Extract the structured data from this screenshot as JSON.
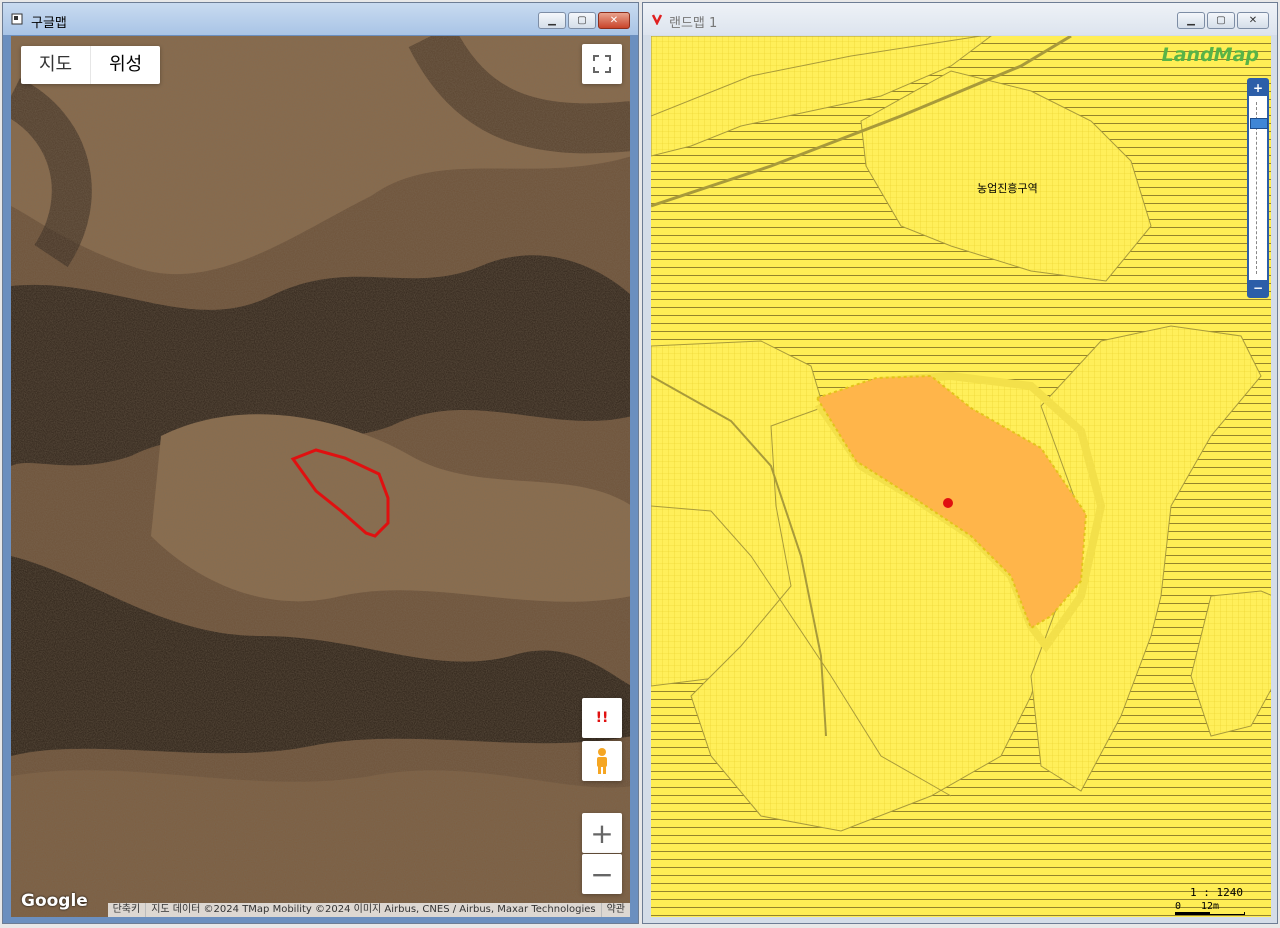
{
  "google_window": {
    "title": "구글맵",
    "map_type": [
      "지도",
      "위성"
    ],
    "logo": "Google",
    "attribution": [
      "단축키",
      "지도 데이터 ©2024 TMap Mobility ©2024 이미지 Airbus, CNES / Airbus, Maxar Technologies",
      "약관"
    ],
    "warn_label": "!!",
    "zoom_in": "+",
    "zoom_out": "−"
  },
  "land_window": {
    "title": "랜드맵 1",
    "logo": "LandMap",
    "zone_label": "농업진흥구역",
    "scale_ratio": "1 : 1240",
    "scale_bar_labels": [
      "0",
      "12m"
    ],
    "zoom_level": 0.1
  },
  "colors": {
    "parcel_fill": "#ffb54a",
    "zone_fill": "#ffee55",
    "outline_red": "#e01010",
    "lm_blue": "#2c5ea8"
  }
}
